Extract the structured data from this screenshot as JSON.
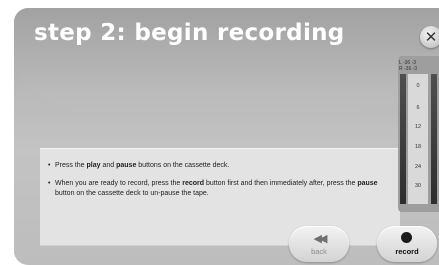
{
  "header": {
    "title": "step 2: begin recording"
  },
  "close": {
    "glyph": "✕",
    "icon": "close-icon"
  },
  "instructions": {
    "item1": {
      "a": "Press the ",
      "b": "play",
      "c": " and ",
      "d": "pause",
      "e": " buttons on the cassette deck."
    },
    "item2": {
      "a": "When you are ready to record, press the ",
      "b": "record",
      "c": " button first and then immediately after, press the ",
      "d": "pause",
      "e": " button on the cassette deck to un-pause the tape."
    }
  },
  "meter": {
    "header_line1": "L  -36 -3",
    "header_line2": "R  -36 -3",
    "marks": [
      "0",
      "6",
      "12",
      "18",
      "24",
      "30"
    ]
  },
  "nav": {
    "back_label": "back",
    "back_icon": "rewind-icon",
    "record_label": "record",
    "record_icon": "record-dot-icon"
  },
  "colors": {
    "panel": "#b9b9b9",
    "instructions_bg": "#e3e3e3",
    "title_text": "#ffffff"
  }
}
